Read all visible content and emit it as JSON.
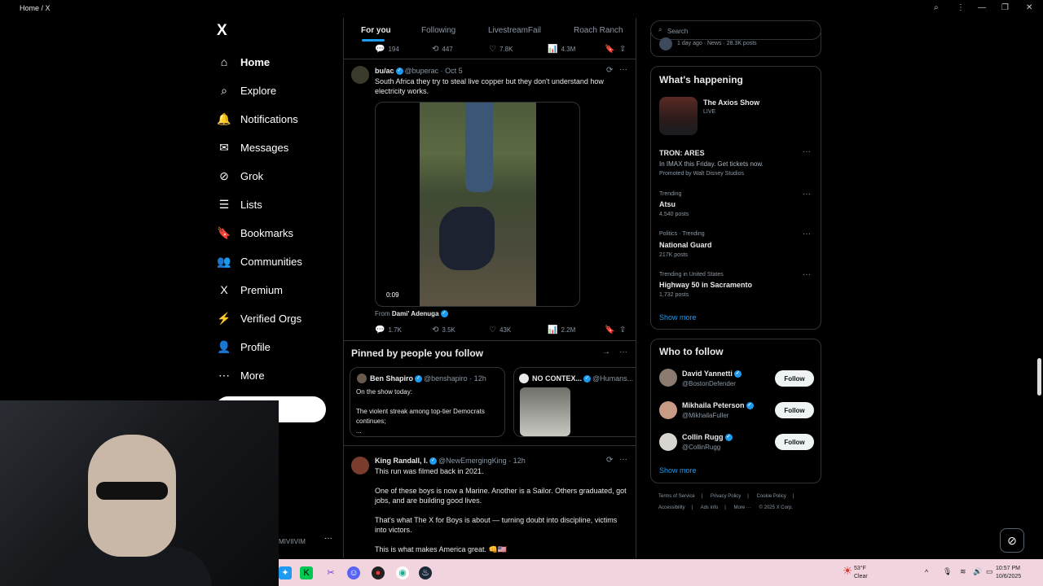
{
  "window": {
    "title": "Home / X"
  },
  "nav": {
    "logo": "X",
    "items": [
      {
        "label": "Home",
        "icon": "home-icon",
        "glyph": "⌂"
      },
      {
        "label": "Explore",
        "icon": "search-icon",
        "glyph": "⌕"
      },
      {
        "label": "Notifications",
        "icon": "bell-icon",
        "glyph": "🔔"
      },
      {
        "label": "Messages",
        "icon": "envelope-icon",
        "glyph": "✉"
      },
      {
        "label": "Grok",
        "icon": "grok-icon",
        "glyph": "⊘"
      },
      {
        "label": "Lists",
        "icon": "list-icon",
        "glyph": "☰"
      },
      {
        "label": "Bookmarks",
        "icon": "bookmark-icon",
        "glyph": "🔖"
      },
      {
        "label": "Communities",
        "icon": "people-icon",
        "glyph": "👥"
      },
      {
        "label": "Premium",
        "icon": "x-logo-icon",
        "glyph": "X"
      },
      {
        "label": "Verified Orgs",
        "icon": "lightning-icon",
        "glyph": "⚡"
      },
      {
        "label": "Profile",
        "icon": "person-icon",
        "glyph": "👤"
      },
      {
        "label": "More",
        "icon": "more-circle-icon",
        "glyph": "⋯"
      }
    ]
  },
  "tabs": [
    "For you",
    "Following",
    "LivestreamFail",
    "Roach Ranch"
  ],
  "top_actions": {
    "replies": "194",
    "reposts": "447",
    "likes": "7.8K",
    "views": "4.3M"
  },
  "tweet1": {
    "name": "bu/ac",
    "handle": "@buperac · Oct 5",
    "text": "South Africa they try to steal live copper but they don't understand how electricity works.",
    "video_duration": "0:09",
    "from_prefix": "From",
    "from_name": "Dami' Adenuga",
    "replies": "1.7K",
    "reposts": "3.5K",
    "likes": "43K",
    "views": "2.2M"
  },
  "pinned": {
    "title": "Pinned by people you follow",
    "card1": {
      "name": "Ben Shapiro",
      "handle": "@benshapiro · 12h",
      "line1": "On the show today:",
      "line2": "The violent streak among top-tier Democrats continues;",
      "line3": "..."
    },
    "card2": {
      "name": "NO CONTEX...",
      "handle": "@Humans..."
    }
  },
  "tweet2": {
    "name": "King Randall, I.",
    "handle": "@NewEmergingKing · 12h",
    "p1": "This run was filmed back in 2021.",
    "p2": "One of these boys is now a Marine. Another is a Sailor. Others graduated, got jobs, and are building good lives.",
    "p3": "That's what The X for Boys is about — turning doubt into discipline, victims into victors.",
    "p4": "This is what makes America great. 👊🇺🇸"
  },
  "search": {
    "placeholder": "Search"
  },
  "top_snippet": "1 day ago · News · 28.3K posts",
  "happening": {
    "title": "What's happening",
    "live_name": "The Axios Show",
    "live_badge": "LIVE",
    "promo_name": "TRON: ARES",
    "promo_desc": "In IMAX this Friday. Get tickets now.",
    "promo_by": "Promoted by Walt Disney Studios",
    "trends": [
      {
        "meta": "Trending",
        "name": "Atsu",
        "posts": "4,540 posts"
      },
      {
        "meta": "Politics · Trending",
        "name": "National Guard",
        "posts": "217K posts"
      },
      {
        "meta": "Trending in United States",
        "name": "Highway 50 in Sacramento",
        "posts": "1,732 posts"
      }
    ],
    "show_more": "Show more"
  },
  "who_to_follow": {
    "title": "Who to follow",
    "users": [
      {
        "name": "David Yannetti",
        "handle": "@BostonDefender"
      },
      {
        "name": "Mikhaila Peterson",
        "handle": "@MikhailaFuller"
      },
      {
        "name": "Collin Rugg",
        "handle": "@CollinRugg"
      }
    ],
    "follow_label": "Follow",
    "show_more": "Show more"
  },
  "footer": {
    "row1": [
      "Terms of Service",
      "|",
      "Privacy Policy",
      "|",
      "Cookie Policy",
      "|"
    ],
    "row2": [
      "Accessibility",
      "|",
      "Ads info",
      "|",
      "More ···",
      "© 2025 X Corp."
    ]
  },
  "sidebar_label": "MIVIIVIM",
  "taskbar": {
    "weather_temp": "53°F",
    "weather_desc": "Clear",
    "time": "10:57 PM",
    "date": "10/6/2025"
  },
  "colors": {
    "accent": "#1d9bf0",
    "background": "#000000",
    "border": "#2f3336",
    "muted": "#8b98a5"
  }
}
